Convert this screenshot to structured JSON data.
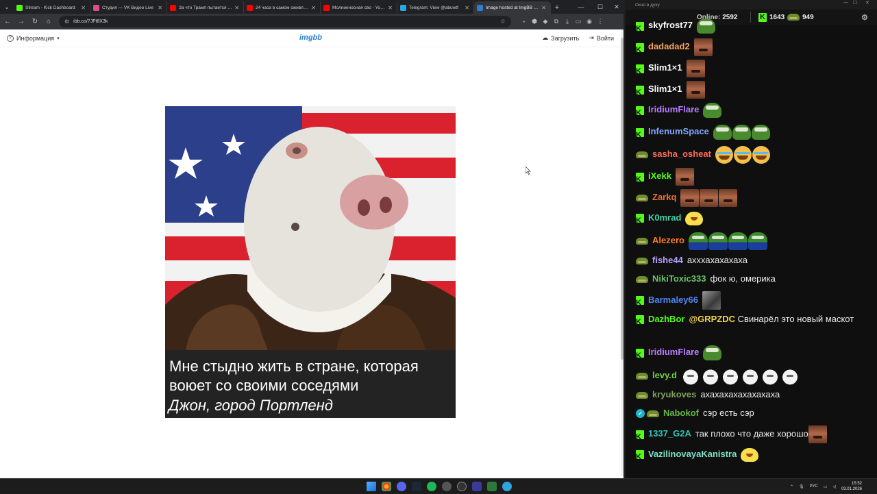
{
  "browser": {
    "tabs": [
      {
        "title": "Stream - Kick Dashboard",
        "color": "#53fc18",
        "active": false
      },
      {
        "title": "Студия — VK Видео Live",
        "color": "#e24b8a",
        "active": false
      },
      {
        "title": "За что Трамп пытается убе...",
        "color": "#ff0000",
        "active": false
      },
      {
        "title": "24 часа в самом оживленн...",
        "color": "#ff0000",
        "active": false
      },
      {
        "title": "Молниеносная сво - YouTu...",
        "color": "#ff0000",
        "active": false
      },
      {
        "title": "Telegram: View @abuwtf",
        "color": "#2ca5e0",
        "active": false
      },
      {
        "title": "Image hosted at ImgBB — I...",
        "color": "#2a7fd4",
        "active": true
      }
    ],
    "url": "ibb.co/7JFt8X3k"
  },
  "imgbb": {
    "info_label": "Информация",
    "logo": "imgbb",
    "upload_label": "Загрузить",
    "login_label": "Войти"
  },
  "meme": {
    "caption": "Мне стыдно жить в стране, которая воюет со своими соседями",
    "author": "Джон, город Портленд"
  },
  "chat": {
    "window_title": "Окно в духу",
    "online_label": "Online:",
    "online_count": "2592",
    "kick_count": "1643",
    "twitch_count": "949",
    "messages": [
      {
        "user": "skyfrost77",
        "color": "#ffffff",
        "platform": "kick",
        "text": "",
        "emotes": [
          "pepe"
        ]
      },
      {
        "user": "dadadad2",
        "color": "#f5a25d",
        "platform": "kick",
        "text": "",
        "emotes": [
          "face"
        ]
      },
      {
        "user": "Slim1×1",
        "color": "#ffffff",
        "platform": "kick",
        "text": "",
        "emotes": [
          "face"
        ]
      },
      {
        "user": "Slim1×1",
        "color": "#ffffff",
        "platform": "kick",
        "text": "",
        "emotes": [
          "face"
        ]
      },
      {
        "user": "IridiumFlare",
        "color": "#b77cff",
        "platform": "kick",
        "text": "",
        "emotes": [
          "pepe"
        ]
      },
      {
        "user": "InfenumSpace",
        "color": "#7fa7ff",
        "platform": "kick",
        "text": "",
        "emotes": [
          "pepe",
          "pepe",
          "pepe"
        ]
      },
      {
        "user": "sasha_osheat",
        "color": "#ff6b5a",
        "platform": "twitch",
        "text": "",
        "emotes": [
          "cry",
          "cry",
          "cry"
        ]
      },
      {
        "user": "iXekk",
        "color": "#53fc18",
        "platform": "kick",
        "text": "",
        "emotes": [
          "face"
        ]
      },
      {
        "user": "Zarkq",
        "color": "#e8742c",
        "platform": "twitch",
        "text": "",
        "emotes": [
          "face",
          "face",
          "face"
        ]
      },
      {
        "user": "K0mrad",
        "color": "#3fd1a6",
        "platform": "kick",
        "text": "",
        "emotes": [
          "yellow"
        ]
      },
      {
        "user": "Alezero",
        "color": "#ff7b1c",
        "platform": "twitch",
        "text": "",
        "emotes": [
          "pepeblue",
          "pepeblue",
          "pepeblue",
          "pepeblue"
        ]
      },
      {
        "user": "fishe44",
        "color": "#b9a2ff",
        "platform": "twitch",
        "text": "ахххахахахаха",
        "emotes": []
      },
      {
        "user": "NikiToxic333",
        "color": "#69c36a",
        "platform": "twitch",
        "text": "фок ю, омерика",
        "emotes": []
      },
      {
        "user": "Barmaley66",
        "color": "#4f86f7",
        "platform": "kick",
        "text": "",
        "emotes": [
          "gray"
        ]
      },
      {
        "user": "DazhBor",
        "color": "#53fc18",
        "platform": "kick",
        "mention": "@GRPZDC",
        "text": "Свинарёл это новый маскот",
        "emotes": []
      },
      {
        "user": "IridiumFlare",
        "color": "#b77cff",
        "platform": "kick",
        "text": "",
        "emotes": [
          "pepe"
        ]
      },
      {
        "user": "levy.d",
        "color": "#73d13d",
        "platform": "twitch",
        "text": "",
        "emotes": [
          "cat",
          "cat",
          "cat",
          "cat",
          "cat",
          "cat"
        ]
      },
      {
        "user": "kryukoves",
        "color": "#7fa05a",
        "platform": "twitch",
        "text": "ахахахахахахахаха",
        "emotes": []
      },
      {
        "user": "Nabokof",
        "color": "#67b74a",
        "platform": "twitch-check",
        "text": "сэр есть сэр",
        "emotes": []
      },
      {
        "user": "1337_G2A",
        "color": "#2ec4b6",
        "platform": "kick",
        "text": "так плохо что даже хорошо",
        "emotes": [
          "face"
        ]
      },
      {
        "user": "VazilinovayaKanistra",
        "color": "#7fe3c9",
        "platform": "kick",
        "text": "",
        "emotes": [
          "yellow"
        ]
      }
    ]
  },
  "taskbar": {
    "lang": "РУС",
    "time": "15:52",
    "date": "03.01.2026"
  }
}
